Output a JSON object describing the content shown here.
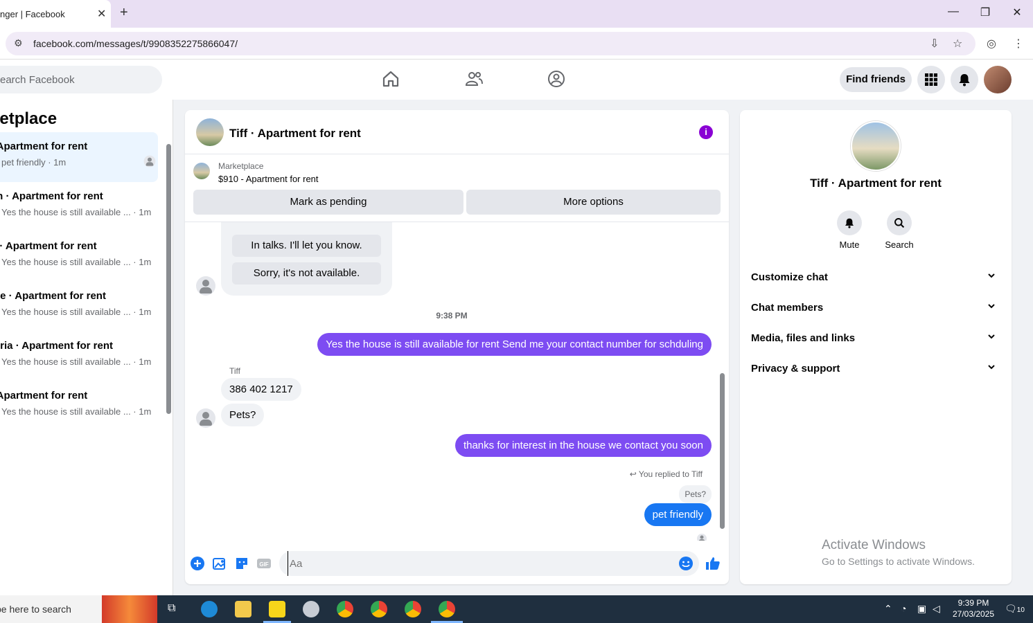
{
  "browser": {
    "tab_title": "nger | Facebook",
    "url": "facebook.com/messages/t/9908352275866047/"
  },
  "fbnav": {
    "search_placeholder": "earch Facebook",
    "find_friends_label": "Find friends"
  },
  "left": {
    "title": "ketplace",
    "chats": [
      {
        "name": "· Apartment for rent",
        "preview": "pet friendly · 1m",
        "active": true
      },
      {
        "name": "on · Apartment for rent",
        "preview": "Yes the house is still available ... · 1m",
        "active": false
      },
      {
        "name": "n · Apartment for rent",
        "preview": "Yes the house is still available ... · 1m",
        "active": false
      },
      {
        "name": "rlie · Apartment for rent",
        "preview": "Yes the house is still available ... · 1m",
        "active": false
      },
      {
        "name": "erria · Apartment for rent",
        "preview": "Yes the house is still available ... · 1m",
        "active": false
      },
      {
        "name": "· Apartment for rent",
        "preview": "Yes the house is still available ... · 1m",
        "active": false
      }
    ]
  },
  "chat": {
    "title": "Tiff · Apartment for rent",
    "marketplace_label": "Marketplace",
    "listing": "$910 - Apartment for rent",
    "mark_pending_label": "Mark as pending",
    "more_options_label": "More options",
    "quick_replies": [
      "In talks. I'll let you know.",
      "Sorry, it's not available."
    ],
    "timestamp": "9:38 PM",
    "sender_name": "Tiff",
    "messages": {
      "out1": "Yes the house is still available for rent Send me your contact number for schduling",
      "in1": "386 402 1217",
      "in2": "Pets?",
      "out2": "thanks for interest in the house we contact you soon",
      "replied_label": "You replied to Tiff",
      "quoted": "Pets?",
      "out3": "pet friendly"
    },
    "composer_placeholder": "Aa"
  },
  "info": {
    "name": "Tiff · Apartment for rent",
    "mute_label": "Mute",
    "search_label": "Search",
    "sections": [
      "Customize chat",
      "Chat members",
      "Media, files and links",
      "Privacy & support"
    ],
    "activate_title": "Activate Windows",
    "activate_sub": "Go to Settings to activate Windows."
  },
  "taskbar": {
    "search_text": "pe here to search",
    "time": "9:39 PM",
    "date": "27/03/2025",
    "notif_count": "10"
  },
  "colors": {
    "accent_purple": "#7d4cf2",
    "accent_blue": "#1877f2",
    "info_purple": "#8a00d4"
  }
}
